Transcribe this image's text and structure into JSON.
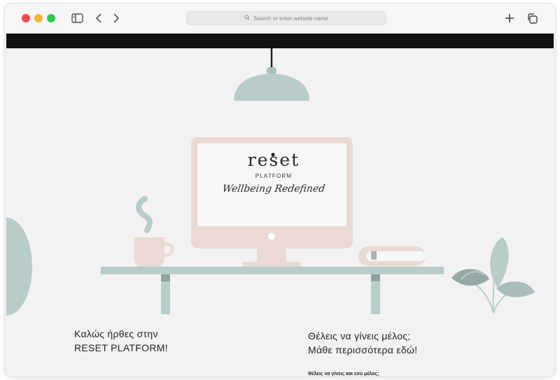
{
  "browser": {
    "address_placeholder": "Search or enter website name",
    "icons": [
      "sidebar-icon",
      "back-icon",
      "forward-icon",
      "search-icon",
      "new-tab-icon",
      "tabs-overview-icon"
    ],
    "traffic_light_colors": {
      "close": "#ed4c4a",
      "minimize": "#f4b73b",
      "zoom": "#33c84a"
    }
  },
  "hero": {
    "brand": "reset",
    "platform": "PLATFORM",
    "tagline": "Wellbeing Redefined"
  },
  "welcome": {
    "line1": "Καλώς ήρθες στην",
    "line2": "RESET PLATFORM!"
  },
  "membership": {
    "line1": "Θέλεις να γίνεις μέλος;",
    "line2": "Μάθε περισσότερα εδώ!",
    "small_heading": "Θέλεις να γίνεις και εσύ μέλος;"
  },
  "colors": {
    "sage": "#b8ccca",
    "blush": "#ead9d4",
    "page_bg": "#f2f2f2"
  }
}
